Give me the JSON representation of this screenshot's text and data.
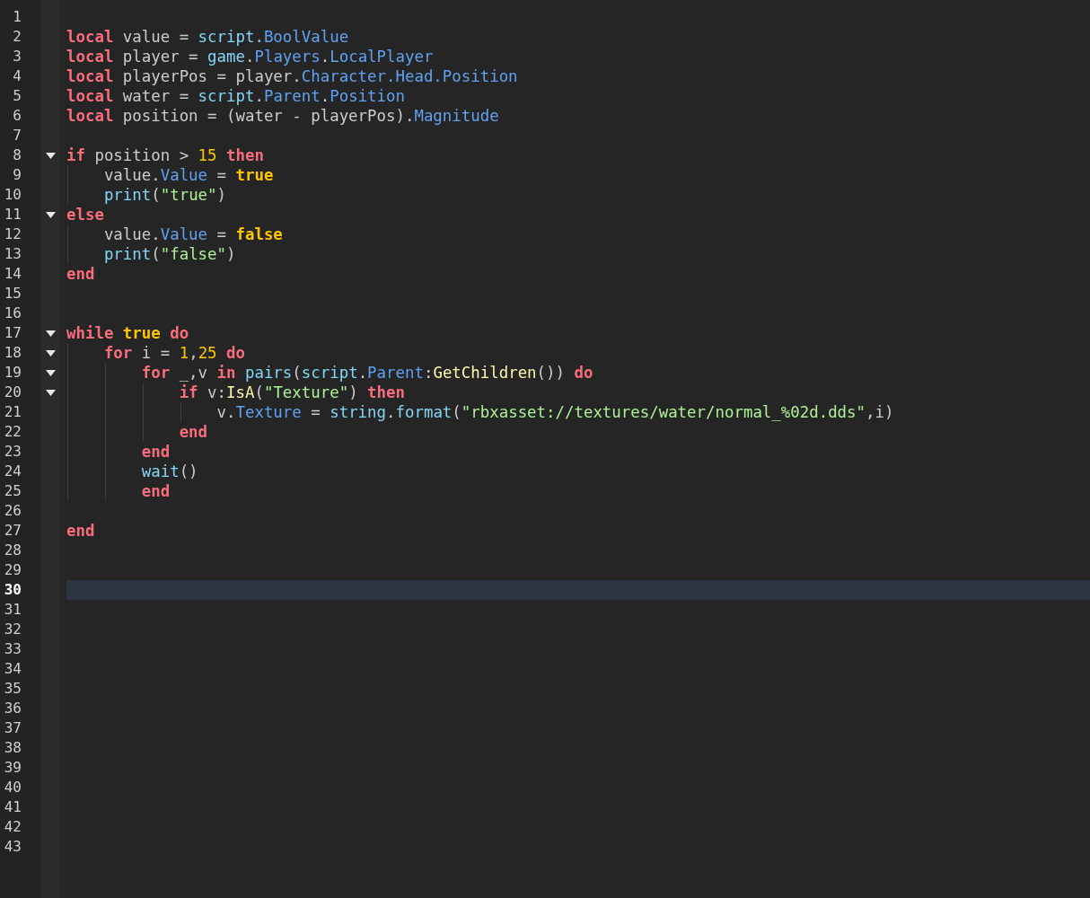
{
  "editor": {
    "lines": [
      {
        "number": "1",
        "fold": false,
        "current": false
      },
      {
        "number": "2",
        "fold": false,
        "current": false,
        "tokens": [
          {
            "kind": "keyword",
            "text": "local"
          },
          {
            "kind": "plain",
            "text": " value = "
          },
          {
            "kind": "global",
            "text": "script."
          },
          {
            "kind": "property",
            "text": "BoolValue"
          }
        ]
      },
      {
        "number": "3",
        "fold": false,
        "current": false,
        "tokens": [
          {
            "kind": "keyword",
            "text": "local"
          },
          {
            "kind": "plain",
            "text": " player = "
          },
          {
            "kind": "global",
            "text": "game"
          },
          {
            "kind": "plain",
            "text": "."
          },
          {
            "kind": "property",
            "text": "Players"
          },
          {
            "kind": "plain",
            "text": "."
          },
          {
            "kind": "property",
            "text": "LocalPlayer"
          }
        ]
      },
      {
        "number": "4",
        "fold": false,
        "current": false,
        "tokens": [
          {
            "kind": "keyword",
            "text": "local"
          },
          {
            "kind": "plain",
            "text": " playerPos = player."
          },
          {
            "kind": "property",
            "text": "Character"
          },
          {
            "kind": "property",
            "text": ".Head"
          },
          {
            "kind": "property",
            "text": ".Position"
          }
        ]
      },
      {
        "number": "5",
        "fold": false,
        "current": false,
        "tokens": [
          {
            "kind": "keyword",
            "text": "local"
          },
          {
            "kind": "plain",
            "text": " water = "
          },
          {
            "kind": "global",
            "text": "script"
          },
          {
            "kind": "plain",
            "text": "."
          },
          {
            "kind": "property",
            "text": "Parent"
          },
          {
            "kind": "plain",
            "text": "."
          },
          {
            "kind": "property",
            "text": "Position"
          }
        ]
      },
      {
        "number": "6",
        "fold": false,
        "current": false,
        "tokens": [
          {
            "kind": "keyword",
            "text": "local"
          },
          {
            "kind": "plain",
            "text": " position = (water - playerPos)."
          },
          {
            "kind": "property",
            "text": "Magnitude"
          }
        ]
      },
      {
        "number": "7",
        "fold": false,
        "current": false
      },
      {
        "number": "8",
        "fold": true,
        "current": false,
        "tokens": [
          {
            "kind": "keyword",
            "text": "if"
          },
          {
            "kind": "plain",
            "text": " position > "
          },
          {
            "kind": "number",
            "text": "15"
          },
          {
            "kind": "keyword",
            "text": " then"
          }
        ]
      },
      {
        "number": "9",
        "fold": false,
        "current": false,
        "tokens": [
          {
            "kind": "plain",
            "text": "    value."
          },
          {
            "kind": "property",
            "text": "Value"
          },
          {
            "kind": "plain",
            "text": " = "
          },
          {
            "kind": "boolean",
            "text": "true"
          }
        ]
      },
      {
        "number": "10",
        "fold": false,
        "current": false,
        "tokens": [
          {
            "kind": "global",
            "text": "    print"
          },
          {
            "kind": "plain",
            "text": "("
          },
          {
            "kind": "string",
            "text": "\"true\""
          },
          {
            "kind": "plain",
            "text": ")"
          }
        ]
      },
      {
        "number": "11",
        "fold": true,
        "current": false,
        "tokens": [
          {
            "kind": "keyword",
            "text": "else"
          }
        ]
      },
      {
        "number": "12",
        "fold": false,
        "current": false,
        "tokens": [
          {
            "kind": "plain",
            "text": "    value."
          },
          {
            "kind": "property",
            "text": "Value"
          },
          {
            "kind": "plain",
            "text": " = "
          },
          {
            "kind": "boolean",
            "text": "false"
          }
        ]
      },
      {
        "number": "13",
        "fold": false,
        "current": false,
        "tokens": [
          {
            "kind": "global",
            "text": "    print"
          },
          {
            "kind": "plain",
            "text": "("
          },
          {
            "kind": "string",
            "text": "\"false\""
          },
          {
            "kind": "plain",
            "text": ")"
          }
        ]
      },
      {
        "number": "14",
        "fold": false,
        "current": false,
        "tokens": [
          {
            "kind": "keyword",
            "text": "end"
          }
        ]
      },
      {
        "number": "15",
        "fold": false,
        "current": false
      },
      {
        "number": "16",
        "fold": false,
        "current": false
      },
      {
        "number": "17",
        "fold": true,
        "current": false,
        "tokens": [
          {
            "kind": "keyword",
            "text": "while"
          },
          {
            "kind": "boolean",
            "text": " true"
          },
          {
            "kind": "keyword",
            "text": " do"
          }
        ]
      },
      {
        "number": "18",
        "fold": true,
        "current": false,
        "tokens": [
          {
            "kind": "keyword",
            "text": "    for"
          },
          {
            "kind": "plain",
            "text": " i = "
          },
          {
            "kind": "number",
            "text": "1"
          },
          {
            "kind": "plain",
            "text": ","
          },
          {
            "kind": "number",
            "text": "25"
          },
          {
            "kind": "keyword",
            "text": " do"
          }
        ]
      },
      {
        "number": "19",
        "fold": true,
        "current": false,
        "tokens": [
          {
            "kind": "keyword",
            "text": "        for"
          },
          {
            "kind": "plain",
            "text": " _,v "
          },
          {
            "kind": "keyword",
            "text": "in"
          },
          {
            "kind": "global",
            "text": " pairs"
          },
          {
            "kind": "plain",
            "text": "("
          },
          {
            "kind": "global",
            "text": "script"
          },
          {
            "kind": "plain",
            "text": "."
          },
          {
            "kind": "property",
            "text": "Parent"
          },
          {
            "kind": "plain",
            "text": ":"
          },
          {
            "kind": "method",
            "text": "GetChildren"
          },
          {
            "kind": "plain",
            "text": "()) "
          },
          {
            "kind": "keyword",
            "text": "do"
          }
        ]
      },
      {
        "number": "20",
        "fold": true,
        "current": false,
        "tokens": [
          {
            "kind": "keyword",
            "text": "            if"
          },
          {
            "kind": "plain",
            "text": " v:"
          },
          {
            "kind": "method",
            "text": "IsA"
          },
          {
            "kind": "plain",
            "text": "("
          },
          {
            "kind": "string",
            "text": "\"Texture\""
          },
          {
            "kind": "plain",
            "text": ") "
          },
          {
            "kind": "keyword",
            "text": "then"
          }
        ]
      },
      {
        "number": "21",
        "fold": false,
        "current": false,
        "tokens": [
          {
            "kind": "plain",
            "text": "                v."
          },
          {
            "kind": "property",
            "text": "Texture"
          },
          {
            "kind": "plain",
            "text": " = "
          },
          {
            "kind": "global",
            "text": "string"
          },
          {
            "kind": "plain",
            "text": "."
          },
          {
            "kind": "global",
            "text": "format"
          },
          {
            "kind": "plain",
            "text": "("
          },
          {
            "kind": "string",
            "text": "\"rbxasset://textures/water/normal_%02d.dds\""
          },
          {
            "kind": "plain",
            "text": ",i)"
          }
        ]
      },
      {
        "number": "22",
        "fold": false,
        "current": false,
        "tokens": [
          {
            "kind": "keyword",
            "text": "            end"
          }
        ]
      },
      {
        "number": "23",
        "fold": false,
        "current": false,
        "tokens": [
          {
            "kind": "keyword",
            "text": "        end"
          }
        ]
      },
      {
        "number": "24",
        "fold": false,
        "current": false,
        "tokens": [
          {
            "kind": "global",
            "text": "        wait"
          },
          {
            "kind": "plain",
            "text": "()"
          }
        ]
      },
      {
        "number": "25",
        "fold": false,
        "current": false,
        "tokens": [
          {
            "kind": "keyword",
            "text": "        end"
          }
        ]
      },
      {
        "number": "26",
        "fold": false,
        "current": false
      },
      {
        "number": "27",
        "fold": false,
        "current": false,
        "tokens": [
          {
            "kind": "keyword",
            "text": "end"
          }
        ]
      },
      {
        "number": "28",
        "fold": false,
        "current": false
      },
      {
        "number": "29",
        "fold": false,
        "current": false
      },
      {
        "number": "30",
        "fold": false,
        "current": true
      },
      {
        "number": "31",
        "fold": false,
        "current": false
      },
      {
        "number": "32",
        "fold": false,
        "current": false
      },
      {
        "number": "33",
        "fold": false,
        "current": false
      },
      {
        "number": "34",
        "fold": false,
        "current": false
      },
      {
        "number": "35",
        "fold": false,
        "current": false
      },
      {
        "number": "36",
        "fold": false,
        "current": false
      },
      {
        "number": "37",
        "fold": false,
        "current": false
      },
      {
        "number": "38",
        "fold": false,
        "current": false
      },
      {
        "number": "39",
        "fold": false,
        "current": false
      },
      {
        "number": "40",
        "fold": false,
        "current": false
      },
      {
        "number": "41",
        "fold": false,
        "current": false
      },
      {
        "number": "42",
        "fold": false,
        "current": false
      },
      {
        "number": "43",
        "fold": false,
        "current": false
      }
    ]
  }
}
